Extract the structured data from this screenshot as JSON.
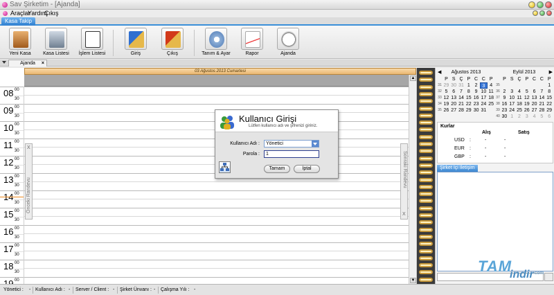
{
  "window": {
    "title": "Sav Şirketim - [Ajanda]"
  },
  "menu": {
    "items": [
      "Araçlar",
      "Yardım",
      "Çıkış"
    ]
  },
  "ribbon": {
    "tab": "Kasa Takip",
    "buttons": [
      {
        "label": "Yeni Kasa",
        "icon": "safe-icon"
      },
      {
        "label": "Kasa Listesi",
        "icon": "cash-register-icon"
      },
      {
        "label": "İşlem Listesi",
        "icon": "document-list-icon"
      },
      {
        "label": "Giriş",
        "icon": "money-in-icon"
      },
      {
        "label": "Çıkış",
        "icon": "money-out-icon"
      },
      {
        "label": "Tanım & Ayar",
        "icon": "settings-icon"
      },
      {
        "label": "Rapor",
        "icon": "report-icon"
      },
      {
        "label": "Ajanda",
        "icon": "clock-icon"
      }
    ]
  },
  "doc_tab": {
    "label": "Ajanda"
  },
  "agenda": {
    "date_header": "03 Ağustos 2013 Cumartesi",
    "hours": [
      "08",
      "09",
      "10",
      "11",
      "12",
      "13",
      "14",
      "15",
      "16",
      "17",
      "18",
      "19"
    ],
    "min00": "00",
    "min30": "30",
    "prev_panel_label": "Önceki Randevu",
    "next_panel_label": "Sonraki Randevu",
    "panel_close": "X"
  },
  "calendar": {
    "weekday_headers": [
      "P",
      "S",
      "Ç",
      "P",
      "C",
      "C",
      "P"
    ],
    "months": [
      {
        "title": "Ağustos 2013",
        "weeks": [
          {
            "wk": "31",
            "days": [
              "29",
              "30",
              "31",
              "1",
              "2",
              "3",
              "4"
            ]
          },
          {
            "wk": "32",
            "days": [
              "5",
              "6",
              "7",
              "8",
              "9",
              "10",
              "11"
            ]
          },
          {
            "wk": "33",
            "days": [
              "12",
              "13",
              "14",
              "15",
              "16",
              "17",
              "18"
            ]
          },
          {
            "wk": "34",
            "days": [
              "19",
              "20",
              "21",
              "22",
              "23",
              "24",
              "25"
            ]
          },
          {
            "wk": "35",
            "days": [
              "26",
              "27",
              "28",
              "29",
              "30",
              "31",
              ""
            ]
          }
        ]
      },
      {
        "title": "Eylül 2013",
        "weeks": [
          {
            "wk": "35",
            "days": [
              "",
              "",
              "",
              "",
              "",
              "",
              "1"
            ]
          },
          {
            "wk": "36",
            "days": [
              "2",
              "3",
              "4",
              "5",
              "6",
              "7",
              "8"
            ]
          },
          {
            "wk": "37",
            "days": [
              "9",
              "10",
              "11",
              "12",
              "13",
              "14",
              "15"
            ]
          },
          {
            "wk": "38",
            "days": [
              "16",
              "17",
              "18",
              "19",
              "20",
              "21",
              "22"
            ]
          },
          {
            "wk": "39",
            "days": [
              "23",
              "24",
              "25",
              "26",
              "27",
              "28",
              "29"
            ]
          },
          {
            "wk": "40",
            "days": [
              "30",
              "1",
              "2",
              "3",
              "4",
              "5",
              "6"
            ]
          }
        ]
      }
    ],
    "prev_arrow": "◀",
    "next_arrow": "▶"
  },
  "kurlar": {
    "title": "Kurlar",
    "col_buy": "Alış",
    "col_sell": "Satış",
    "rows": [
      {
        "code": "USD",
        "sep": ":",
        "buy": "-",
        "sell": "-"
      },
      {
        "code": "EUR",
        "sep": ":",
        "buy": "-",
        "sell": "-"
      },
      {
        "code": "GBP",
        "sep": ":",
        "buy": "-",
        "sell": "-"
      }
    ]
  },
  "messages": {
    "tab": "Şirket İçi İletişim"
  },
  "dialog": {
    "title": "Kullanıcı Girişi",
    "subtitle": "Lütfen kullanıcı adı ve şifrenizi giriniz.",
    "user_label": "Kullanıcı Adı :",
    "user_value": "Yönetici",
    "pass_label": "Parola :",
    "pass_value": "1",
    "ok": "Tamam",
    "cancel": "İptal"
  },
  "status": {
    "items": [
      "Yönetici :",
      "-",
      "Kullanıcı Adı :",
      "-",
      "Server / Client :",
      "-",
      "Şirket Ünvanı :",
      "-",
      "Çalışma Yılı :",
      "-"
    ]
  },
  "watermark": {
    "line1": "TAM",
    "line2": "indir",
    "line3": ".com"
  },
  "colors": {
    "accent": "#3a8fd8",
    "date_header": "#e9b772",
    "now_line": "#f08a1e"
  }
}
